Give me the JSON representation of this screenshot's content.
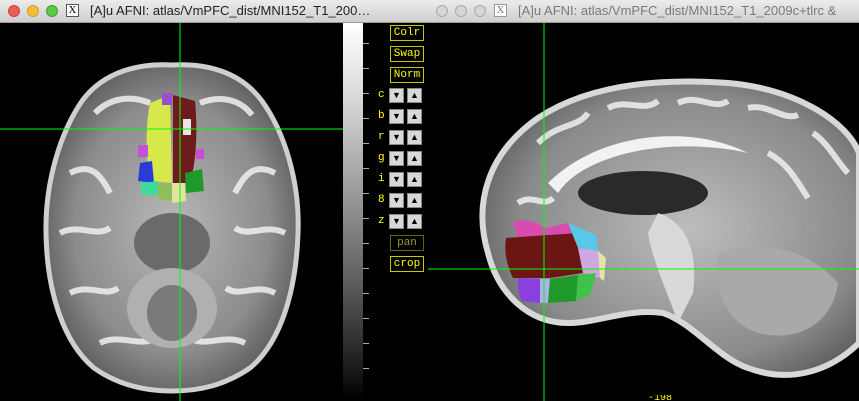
{
  "left_window": {
    "title": "[A]u AFNI: atlas/VmPFC_dist/MNI152_T1_200…",
    "close_icon": "X"
  },
  "right_window": {
    "title": "[A]u AFNI: atlas/VmPFC_dist/MNI152_T1_2009c+tlrc &",
    "close_icon": "X",
    "bottom_readout": "-198"
  },
  "controls": {
    "colr_label": "Colr",
    "swap_label": "Swap",
    "norm_label": "Norm",
    "rows": [
      {
        "label": "c"
      },
      {
        "label": "b"
      },
      {
        "label": "r"
      },
      {
        "label": "g"
      },
      {
        "label": "i"
      },
      {
        "label": "8"
      },
      {
        "label": "z"
      }
    ],
    "pan_label": "pan",
    "crop_label": "crop"
  },
  "colors": {
    "accent_text": "#ffff00",
    "crosshair": "#00ff00"
  }
}
